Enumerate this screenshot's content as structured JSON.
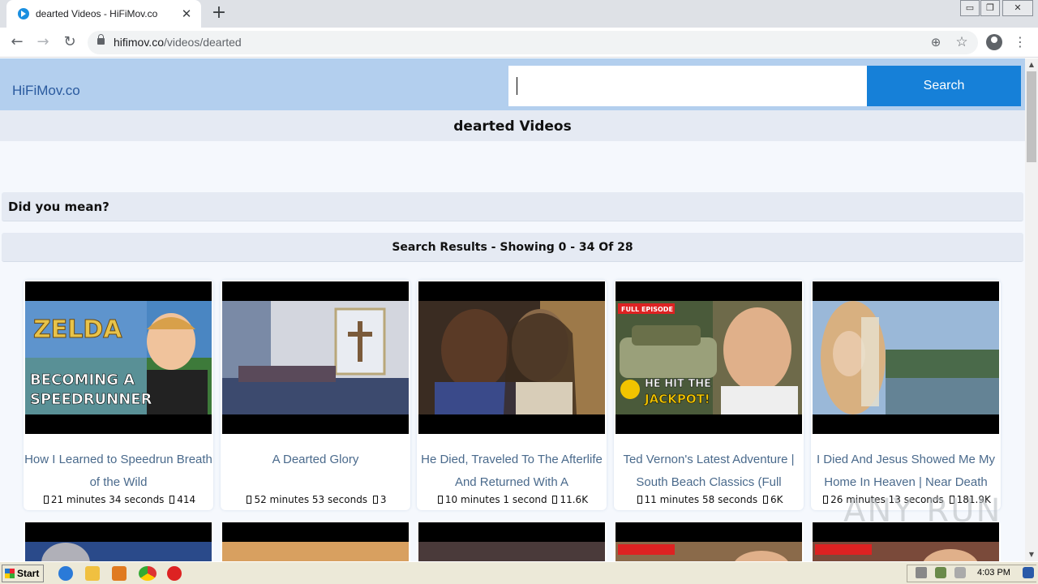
{
  "browser": {
    "tab_title": "dearted Videos - HiFiMov.co",
    "tab_close": "✕",
    "new_tab": "+",
    "url_domain": "hifimov.co",
    "url_path": "/videos/dearted",
    "back": "←",
    "forward": "→",
    "reload": "↻",
    "install_icon": "⊕",
    "bookmark_icon": "☆",
    "menu": "⋮",
    "win_min": "▭",
    "win_restore": "❐",
    "win_close": "✕"
  },
  "site": {
    "logo": "HiFiMov.co",
    "search_value": "",
    "search_button": "Search",
    "page_title": "dearted Videos",
    "did_you_mean": "Did you mean?",
    "results_summary": "Search Results - Showing 0 - 34 Of 28",
    "watermark": "ANY RUN"
  },
  "videos": [
    {
      "title": "How I Learned to Speedrun Breath of the Wild",
      "duration": "21 minutes 34 seconds",
      "views": "414",
      "thumb_color": "#3a76b8",
      "thumb_text": "BECOMING A SPEEDRUNNER"
    },
    {
      "title": "A Dearted Glory",
      "duration": "52 minutes 53 seconds",
      "views": "3",
      "thumb_color": "#c9ccd6",
      "thumb_text": ""
    },
    {
      "title": "He Died, Traveled To The Afterlife And Returned With A",
      "duration": "10 minutes 1 second",
      "views": "11.6K",
      "thumb_color": "#6e5136",
      "thumb_text": ""
    },
    {
      "title": "Ted Vernon's Latest Adventure | South Beach Classics (Full",
      "duration": "11 minutes 58 seconds",
      "views": "6K",
      "thumb_color": "#8c7a52",
      "thumb_text": "HE HIT THE JACKPOT!"
    },
    {
      "title": "I Died And Jesus Showed Me My Home In Heaven | Near Death",
      "duration": "26 minutes 13 seconds",
      "views": "181.9K",
      "thumb_color": "#b5a77a",
      "thumb_text": ""
    }
  ],
  "taskbar": {
    "start": "Start",
    "clock": "4:03 PM"
  }
}
